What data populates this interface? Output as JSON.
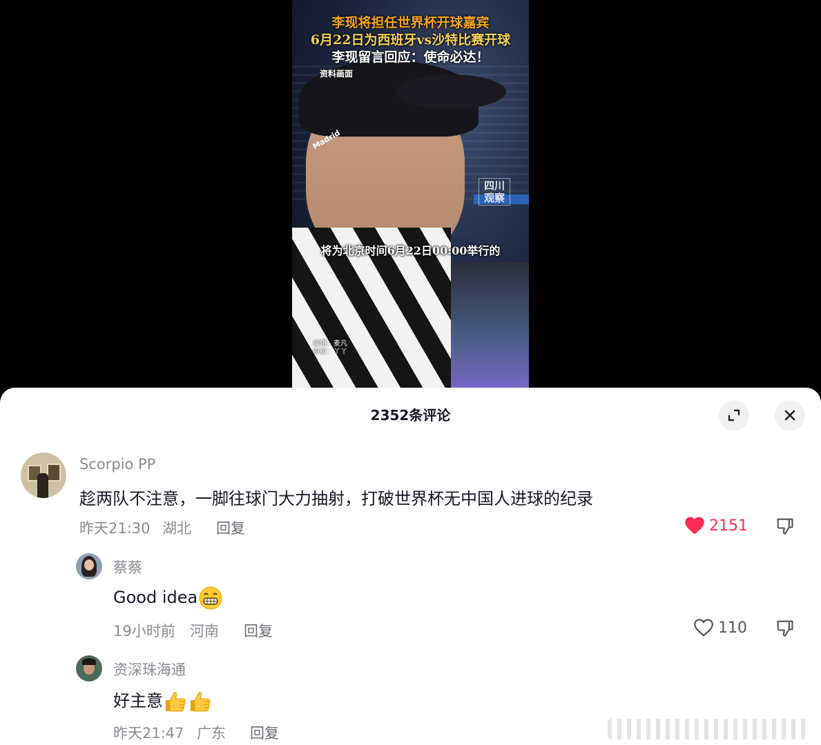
{
  "video": {
    "title_line1": "李现将担任世界杯开球嘉宾",
    "title_line2": "6月22日为西班牙vs沙特比赛开球",
    "title_line3": "李现留言回应：使命必达！",
    "source_label": "资料画面",
    "watermark_line1": "四川",
    "watermark_line2": "观察",
    "subtitle": "将为北京时间6月22日00:00举行的",
    "credit_editor": "编辑：麦凡",
    "credit_reviewer": "审校：丫丫",
    "cap_text": "Madrid"
  },
  "sheet": {
    "title": "2352条评论",
    "expand_icon": "expand-icon",
    "close_icon": "close-icon"
  },
  "comments": [
    {
      "username": "Scorpio PP",
      "text": "趁两队不注意，一脚往球门大力抽射，打破世界杯无中国人进球的纪录",
      "time": "昨天21:30",
      "location": "湖北",
      "reply_label": "回复",
      "likes": "2151",
      "liked": true
    },
    {
      "username": "蔡蔡",
      "text": "Good idea",
      "emoji": "grinning-face",
      "time": "19小时前",
      "location": "河南",
      "reply_label": "回复",
      "likes": "110",
      "liked": false
    },
    {
      "username": "资深珠海通",
      "text": "好主意",
      "emoji": "thumbs-up x2",
      "time": "昨天21:47",
      "location": "广东",
      "reply_label": "回复"
    }
  ],
  "colors": {
    "like_red": "#fe2c55",
    "text_primary": "#161823",
    "text_secondary": "#8a8b91"
  }
}
